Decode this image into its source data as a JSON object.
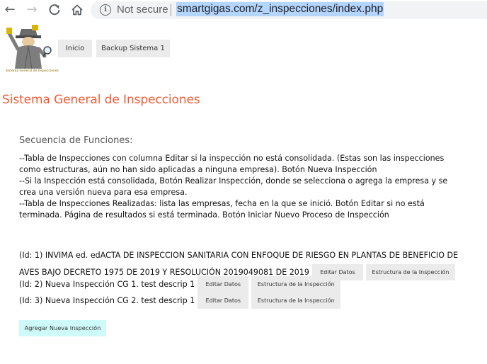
{
  "browser": {
    "security_label": "Not secure",
    "url": "smartgigas.com/z_inspecciones/index.php"
  },
  "header": {
    "logo_caption": "Sistema General de Inspecciones",
    "menu": [
      {
        "label": "Inicio"
      },
      {
        "label": "Backup Sistema 1"
      }
    ]
  },
  "page": {
    "title": "Sistema General de Inspecciones",
    "sequence_heading": "Secuencia de Funciones:",
    "sequence_lines": [
      "--Tabla de Inspecciones con columna Editar si la inspección no está consolidada. (Estas son las inspecciones",
      "como estructuras, aún no han sido aplicadas a ninguna empresa). Botón Nueva Inspección",
      "--Si la Inspección está consolidada, Botón Realizar Inspección, donde se selecciona o agrega la empresa y se",
      "crea una versión nueva para esa empresa.",
      "--Tabla de Inspecciones Realizadas: lista las empresas, fecha en la que se inició. Botón Editar si no está",
      "terminada. Página de resultados si está terminada. Botón Iniciar Nuevo Proceso de Inspección"
    ]
  },
  "inspections": [
    {
      "text_line1": "(Id: 1) INVIMA ed. edACTA DE INSPECCION SANITARIA CON ENFOQUE DE RIESGO EN PLANTAS DE BENEFICIO DE",
      "text_line2": "AVES BAJO DECRETO 1975 DE 2019 Y RESOLUCIÓN 2019049081 DE 2019",
      "edit_label": "Editar Datos",
      "structure_label": "Estructura de la Inspección"
    },
    {
      "text": "(Id: 2) Nueva Inspección CG 1. test descrip 1",
      "edit_label": "Editar Datos",
      "structure_label": "Estructura de la Inspección"
    },
    {
      "text": "(Id: 3) Nueva Inspección CG 2. test descrip 1",
      "edit_label": "Editar Datos",
      "structure_label": "Estructura de la Inspección"
    }
  ],
  "add_button_label": "Agregar Nueva Inspección",
  "icons": {
    "back": "arrow-left-icon",
    "forward": "arrow-right-icon",
    "reload": "reload-icon",
    "home": "home-icon",
    "info": "info-icon",
    "logo": "inspector-logo-icon"
  },
  "colors": {
    "title": "#f05c36",
    "button_bg": "#ebebeb",
    "add_button_bg": "#cffafa",
    "url_highlight": "#b4d5fe"
  }
}
